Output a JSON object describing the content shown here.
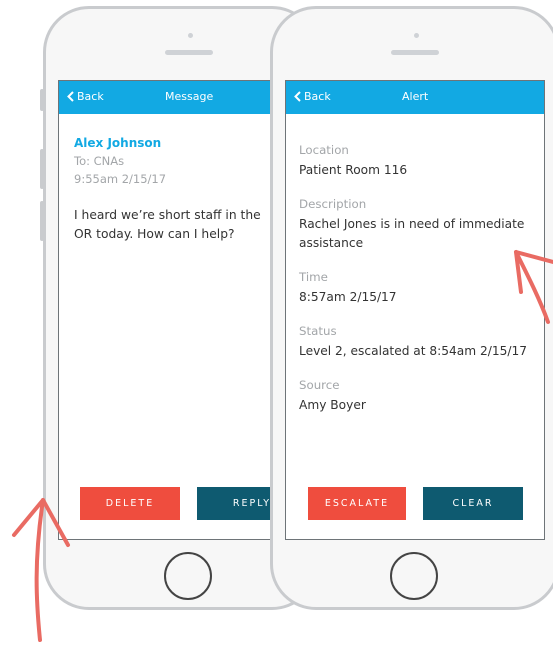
{
  "message_screen": {
    "nav_back": "Back",
    "nav_title": "Message",
    "sender": "Alex Johnson",
    "to": "To: CNAs",
    "timestamp": "9:55am 2/15/17",
    "body": "I heard we’re short staff in the OR today. How can I help?",
    "delete_label": "DELETE",
    "reply_label": "REPLY"
  },
  "alert_screen": {
    "nav_back": "Back",
    "nav_title": "Alert",
    "fields": [
      {
        "label": "Location",
        "value": "Patient Room 116"
      },
      {
        "label": "Description",
        "value": "Rachel Jones is in need of immediate assistance"
      },
      {
        "label": "Time",
        "value": "8:57am 2/15/17"
      },
      {
        "label": "Status",
        "value": "Level 2, escalated at 8:54am 2/15/17"
      },
      {
        "label": "Source",
        "value": "Amy Boyer"
      }
    ],
    "escalate_label": "ESCALATE",
    "clear_label": "CLEAR"
  },
  "colors": {
    "nav_blue": "#12a9e3",
    "button_red": "#ef4d3e",
    "button_teal": "#0e5a70",
    "arrow": "#e96b63"
  }
}
